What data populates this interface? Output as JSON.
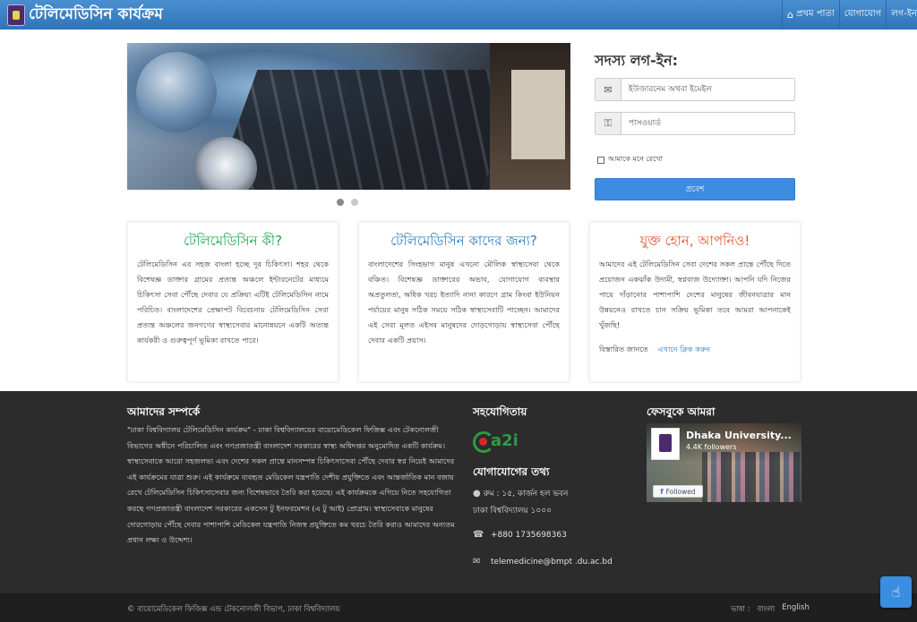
{
  "header": {
    "site_title": "টেলিমেডিসিন কার্যক্রম",
    "nav": [
      {
        "label": "প্রথম পাতা",
        "icon": "home-icon"
      },
      {
        "label": "যোগাযোগ"
      },
      {
        "label": "লগ-ইন"
      }
    ]
  },
  "carousel": {
    "slide_count": 2,
    "active_slide": 1
  },
  "login": {
    "title": "সদস্য লগ-ইন:",
    "username_placeholder": "ইউজারনেম অথবা ইমেইল",
    "password_placeholder": "পাসওয়ার্ড",
    "remember_label": "আমাকে মনে রেখো",
    "submit_label": "প্রবেশ",
    "submit_color": "#3c8de0"
  },
  "info_boxes": [
    {
      "title": "টেলিমেডিসিন কী?",
      "title_color": "#1aa84f",
      "body": "টেলিমেডিসিন এর সহজ বাংলা হচ্ছে দূর চিকিৎসা। শহর থেকে বিশেষজ্ঞ ডাক্তার গ্রামের প্রত্যন্ত অঞ্চলে ইন্টারনেটের মাধ্যমে চিকিৎসা সেবা পৌঁছে দেবার যে প্রক্রিয়া এটিই টেলিমেডিসিন নামে পরিচিত। বাংলাদেশের প্রেক্ষাপট বিবেচনায় টেলিমেডিসিন সেবা প্রত্যন্ত অঞ্চলের জনগণের স্বাস্থ্যসেবার মানোন্নয়নে একটি অত্যন্ত কার্যকরী ও গুরুত্বপূর্ণ ভূমিকা রাখতে পারে।"
    },
    {
      "title": "টেলিমেডিসিন কাদের জন্য?",
      "title_color": "#2a7ec0",
      "body": "বাংলাদেশের সিংহভাগ মানুষ এখনো মৌলিক স্বাস্থ্যসেবা থেকে বঞ্চিত। বিশেষজ্ঞ ডাক্তারের অভাব, যোগাযোগ ব্যবস্থার অপ্রতুলতা, অধিক খরচ ইত্যাদি নানা কারণে গ্রাম কিংবা ইউনিয়ন পর্যায়ের মানুষ সঠিক সময়ে সঠিক স্বাস্থ্যসেবাটি পাচ্ছেন। আমাদের এই সেবা মূলত এইসব মানুষদের দোড়গোড়ায় স্বাস্থ্যসেবা পৌঁছে দেবার একটি প্রয়াস।"
    },
    {
      "title": "যুক্ত হোন, আপনিও!",
      "title_color": "#e8552f",
      "body": "আমাদের এই টেলিমেডিসিন সেবা দেশের সকল প্রান্তে পৌঁছে দিতে প্রয়োজন একঝাঁক উদ্যমী, স্বপ্নবাজ উদ্যোক্তা। আপনি যদি নিজের পায়ে দাঁড়ানোর পাশাপাশি দেশের মানুষের জীবনযাত্রার মান উন্নয়নেও রাখতে চান সক্রিয় ভূমিকা তবে আমরা আপনাকেই খুঁজছি!",
      "more_label": "বিস্তারিত জানতে",
      "more_link": "এখানে ক্লিক করুন"
    }
  ],
  "footer": {
    "about_title": "আমাদের সম্পর্কে",
    "about_text": "\"ঢাকা বিশ্ববিদ্যালয় টেলিমেডিসিন কার্যক্রম\" - ঢাকা বিশ্ববিদ্যালয়ের বায়োমেডিকেল ফিজিক্স এবং টেকনোলজী বিভাগের অধীনে পরিচালিত এবং গণপ্রজাতন্ত্রী বাংলাদেশ সরকারের স্বাস্থ্য অধিদপ্তর অনুমোদিত একটি কার্যক্রম। স্বাস্থ্যসেবাকে আরো সহজলভ্য এবং দেশের সকল প্রান্তে মানসম্পন্ন চিকিৎসাসেবা পৌঁছে দেবার স্বপ্ন নিয়েই আমাদের এই কার্যক্রমের যাত্রা শুরু। এই কার্যক্রমে ব্যবহৃত মেডিকেল যন্ত্রপাতি দেশীয় প্রযুক্তিতে এবং আন্তর্জাতিক মান বজায় রেখে টেলিমেডিসিন চিকিৎসাসেবার জন্য বিশেষভাবে তৈরি করা হয়েছে। এই কার্যক্রমকে এগিয়ে নিতে সহযোগিতা করছে গণপ্রজাতন্ত্রী বাংলাদেশ সরকারের একসেস টু ইনফরমেশন (এ টু আই) প্রোগ্রাম। স্বাস্থ্যসেবাকে মানুষের দোরগোড়ায় পৌঁছে দেবার পাশাপাশি মেডিকেল যন্ত্রপাতি নিজস্ব প্রযুক্তিতে কম খরচে তৈরি করাও আমাদের অন্যতম প্রধান লক্ষ্য ও উদ্দেশ্য।",
    "partner_title": "সহযোগিতায়",
    "partner_logo_text": "a2i",
    "contact_title": "যোগাযোগের তথ্য",
    "address_line1": "রুম : ১৫, কার্জন হল ভবন",
    "address_line2": "ঢাকা বিশ্ববিদ্যালয় ১০০০",
    "phone": "+880 1735698363",
    "email": "telemedicine@bmpt .du.ac.bd",
    "facebook_title": "ফেসবুকে আমরা",
    "fb_page_name": "Dhaka University...",
    "fb_followers": "4.4K followers",
    "fb_follow_label": "Followed",
    "copyright": "© বায়োমেডিকেল ফিজিক্স এন্ড টেকনোলজী বিভাগ, ঢাকা বিশ্ববিদ্যালয়",
    "language_label": "ভাষা :",
    "lang_bn": "বাংলা",
    "lang_en": "English"
  }
}
